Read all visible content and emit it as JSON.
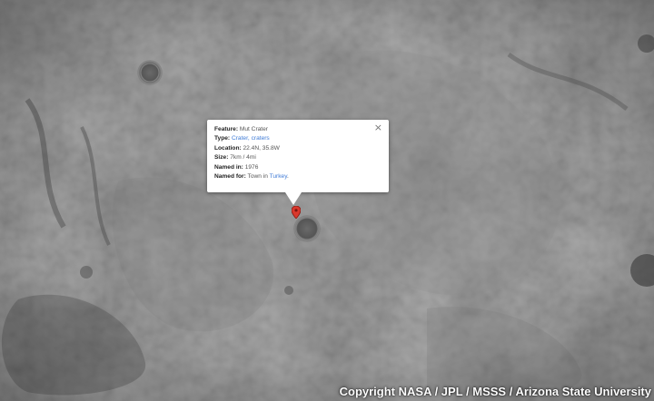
{
  "popup": {
    "close_label": "×",
    "rows": [
      {
        "label": "Feature:",
        "value": "Mut Crater"
      },
      {
        "label": "Type:",
        "value_link": "Crater, craters"
      },
      {
        "label": "Location:",
        "value": "22.4N, 35.8W"
      },
      {
        "label": "Size:",
        "value": "7km / 4mi"
      },
      {
        "label": "Named in:",
        "value": "1976"
      },
      {
        "label": "Named for:",
        "value": "Town in ",
        "value_link": "Turkey",
        "value_suffix": "."
      }
    ]
  },
  "marker": {
    "icon": "map-pin-icon",
    "color": "#d9382c"
  },
  "attribution": "Copyright NASA / JPL / MSSS / Arizona State University",
  "colors": {
    "link": "#3f7bd6",
    "terrain": "#5a5a5a"
  }
}
